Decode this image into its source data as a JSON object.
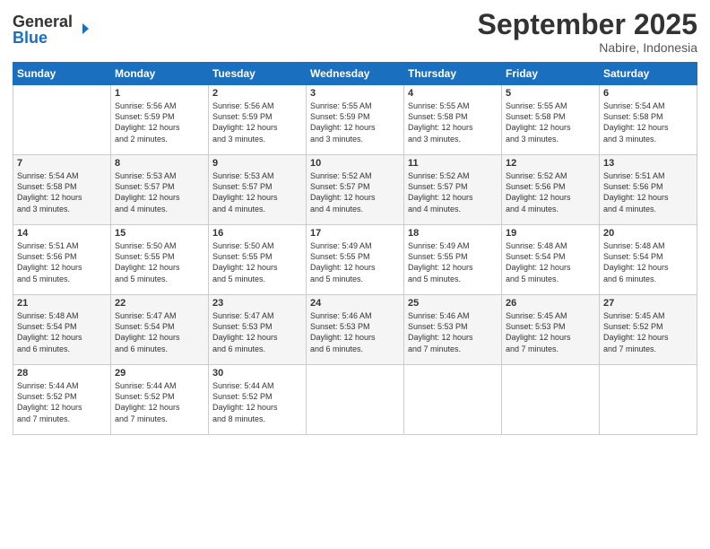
{
  "header": {
    "logo_general": "General",
    "logo_blue": "Blue",
    "month_year": "September 2025",
    "location": "Nabire, Indonesia"
  },
  "calendar": {
    "days_of_week": [
      "Sunday",
      "Monday",
      "Tuesday",
      "Wednesday",
      "Thursday",
      "Friday",
      "Saturday"
    ],
    "weeks": [
      [
        {
          "day": "",
          "text": ""
        },
        {
          "day": "1",
          "text": "Sunrise: 5:56 AM\nSunset: 5:59 PM\nDaylight: 12 hours\nand 2 minutes."
        },
        {
          "day": "2",
          "text": "Sunrise: 5:56 AM\nSunset: 5:59 PM\nDaylight: 12 hours\nand 3 minutes."
        },
        {
          "day": "3",
          "text": "Sunrise: 5:55 AM\nSunset: 5:59 PM\nDaylight: 12 hours\nand 3 minutes."
        },
        {
          "day": "4",
          "text": "Sunrise: 5:55 AM\nSunset: 5:58 PM\nDaylight: 12 hours\nand 3 minutes."
        },
        {
          "day": "5",
          "text": "Sunrise: 5:55 AM\nSunset: 5:58 PM\nDaylight: 12 hours\nand 3 minutes."
        },
        {
          "day": "6",
          "text": "Sunrise: 5:54 AM\nSunset: 5:58 PM\nDaylight: 12 hours\nand 3 minutes."
        }
      ],
      [
        {
          "day": "7",
          "text": "Sunrise: 5:54 AM\nSunset: 5:58 PM\nDaylight: 12 hours\nand 3 minutes."
        },
        {
          "day": "8",
          "text": "Sunrise: 5:53 AM\nSunset: 5:57 PM\nDaylight: 12 hours\nand 4 minutes."
        },
        {
          "day": "9",
          "text": "Sunrise: 5:53 AM\nSunset: 5:57 PM\nDaylight: 12 hours\nand 4 minutes."
        },
        {
          "day": "10",
          "text": "Sunrise: 5:52 AM\nSunset: 5:57 PM\nDaylight: 12 hours\nand 4 minutes."
        },
        {
          "day": "11",
          "text": "Sunrise: 5:52 AM\nSunset: 5:57 PM\nDaylight: 12 hours\nand 4 minutes."
        },
        {
          "day": "12",
          "text": "Sunrise: 5:52 AM\nSunset: 5:56 PM\nDaylight: 12 hours\nand 4 minutes."
        },
        {
          "day": "13",
          "text": "Sunrise: 5:51 AM\nSunset: 5:56 PM\nDaylight: 12 hours\nand 4 minutes."
        }
      ],
      [
        {
          "day": "14",
          "text": "Sunrise: 5:51 AM\nSunset: 5:56 PM\nDaylight: 12 hours\nand 5 minutes."
        },
        {
          "day": "15",
          "text": "Sunrise: 5:50 AM\nSunset: 5:55 PM\nDaylight: 12 hours\nand 5 minutes."
        },
        {
          "day": "16",
          "text": "Sunrise: 5:50 AM\nSunset: 5:55 PM\nDaylight: 12 hours\nand 5 minutes."
        },
        {
          "day": "17",
          "text": "Sunrise: 5:49 AM\nSunset: 5:55 PM\nDaylight: 12 hours\nand 5 minutes."
        },
        {
          "day": "18",
          "text": "Sunrise: 5:49 AM\nSunset: 5:55 PM\nDaylight: 12 hours\nand 5 minutes."
        },
        {
          "day": "19",
          "text": "Sunrise: 5:48 AM\nSunset: 5:54 PM\nDaylight: 12 hours\nand 5 minutes."
        },
        {
          "day": "20",
          "text": "Sunrise: 5:48 AM\nSunset: 5:54 PM\nDaylight: 12 hours\nand 6 minutes."
        }
      ],
      [
        {
          "day": "21",
          "text": "Sunrise: 5:48 AM\nSunset: 5:54 PM\nDaylight: 12 hours\nand 6 minutes."
        },
        {
          "day": "22",
          "text": "Sunrise: 5:47 AM\nSunset: 5:54 PM\nDaylight: 12 hours\nand 6 minutes."
        },
        {
          "day": "23",
          "text": "Sunrise: 5:47 AM\nSunset: 5:53 PM\nDaylight: 12 hours\nand 6 minutes."
        },
        {
          "day": "24",
          "text": "Sunrise: 5:46 AM\nSunset: 5:53 PM\nDaylight: 12 hours\nand 6 minutes."
        },
        {
          "day": "25",
          "text": "Sunrise: 5:46 AM\nSunset: 5:53 PM\nDaylight: 12 hours\nand 7 minutes."
        },
        {
          "day": "26",
          "text": "Sunrise: 5:45 AM\nSunset: 5:53 PM\nDaylight: 12 hours\nand 7 minutes."
        },
        {
          "day": "27",
          "text": "Sunrise: 5:45 AM\nSunset: 5:52 PM\nDaylight: 12 hours\nand 7 minutes."
        }
      ],
      [
        {
          "day": "28",
          "text": "Sunrise: 5:44 AM\nSunset: 5:52 PM\nDaylight: 12 hours\nand 7 minutes."
        },
        {
          "day": "29",
          "text": "Sunrise: 5:44 AM\nSunset: 5:52 PM\nDaylight: 12 hours\nand 7 minutes."
        },
        {
          "day": "30",
          "text": "Sunrise: 5:44 AM\nSunset: 5:52 PM\nDaylight: 12 hours\nand 8 minutes."
        },
        {
          "day": "",
          "text": ""
        },
        {
          "day": "",
          "text": ""
        },
        {
          "day": "",
          "text": ""
        },
        {
          "day": "",
          "text": ""
        }
      ]
    ]
  }
}
